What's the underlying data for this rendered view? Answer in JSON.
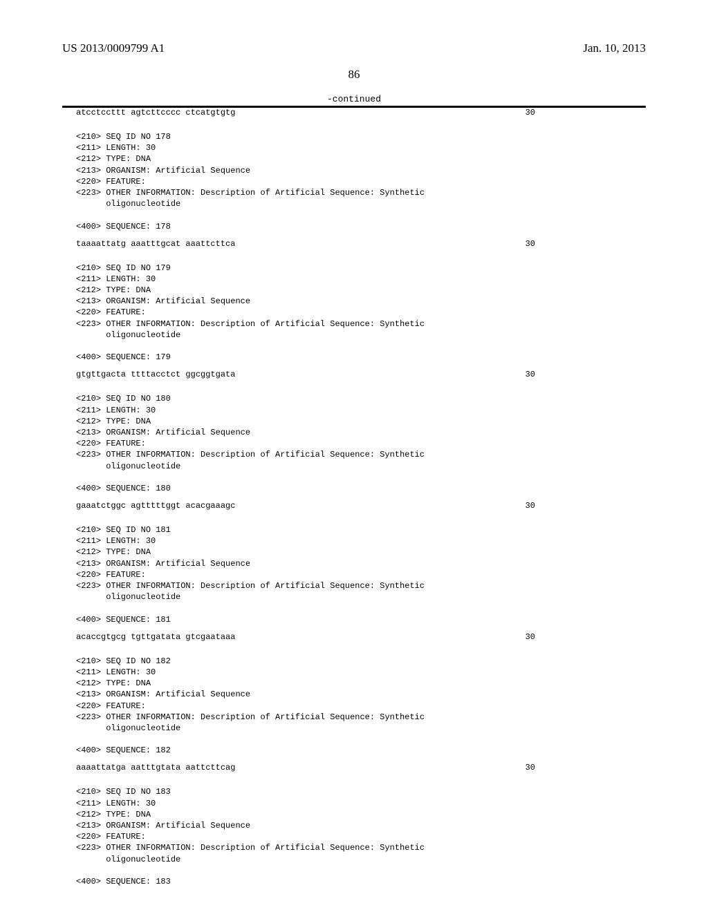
{
  "header": {
    "pub_number": "US 2013/0009799 A1",
    "date": "Jan. 10, 2013"
  },
  "page_number": "86",
  "continued_label": "-continued",
  "prev_sequence": {
    "data": "atcctccttt agtcttcccc ctcatgtgtg",
    "length": "30"
  },
  "entries": [
    {
      "id": "178",
      "length": "30",
      "type": "DNA",
      "organism": "Artificial Sequence",
      "feature": "",
      "other_info": "Description of Artificial Sequence: Synthetic",
      "other_info_cont": "oligonucleotide",
      "sequence_label": "178",
      "seq_data": "taaaattatg aaatttgcat aaattcttca",
      "seq_len": "30"
    },
    {
      "id": "179",
      "length": "30",
      "type": "DNA",
      "organism": "Artificial Sequence",
      "feature": "",
      "other_info": "Description of Artificial Sequence: Synthetic",
      "other_info_cont": "oligonucleotide",
      "sequence_label": "179",
      "seq_data": "gtgttgacta ttttacctct ggcggtgata",
      "seq_len": "30"
    },
    {
      "id": "180",
      "length": "30",
      "type": "DNA",
      "organism": "Artificial Sequence",
      "feature": "",
      "other_info": "Description of Artificial Sequence: Synthetic",
      "other_info_cont": "oligonucleotide",
      "sequence_label": "180",
      "seq_data": "gaaatctggc agtttttggt acacgaaagc",
      "seq_len": "30"
    },
    {
      "id": "181",
      "length": "30",
      "type": "DNA",
      "organism": "Artificial Sequence",
      "feature": "",
      "other_info": "Description of Artificial Sequence: Synthetic",
      "other_info_cont": "oligonucleotide",
      "sequence_label": "181",
      "seq_data": "acaccgtgcg tgttgatata gtcgaataaa",
      "seq_len": "30"
    },
    {
      "id": "182",
      "length": "30",
      "type": "DNA",
      "organism": "Artificial Sequence",
      "feature": "",
      "other_info": "Description of Artificial Sequence: Synthetic",
      "other_info_cont": "oligonucleotide",
      "sequence_label": "182",
      "seq_data": "aaaattatga aatttgtata aattcttcag",
      "seq_len": "30"
    },
    {
      "id": "183",
      "length": "30",
      "type": "DNA",
      "organism": "Artificial Sequence",
      "feature": "",
      "other_info": "Description of Artificial Sequence: Synthetic",
      "other_info_cont": "oligonucleotide",
      "sequence_label": "183",
      "seq_data": "",
      "seq_len": ""
    }
  ],
  "labels": {
    "seq_id": "<210> SEQ ID NO ",
    "length": "<211> LENGTH: ",
    "type": "<212> TYPE: ",
    "organism": "<213> ORGANISM: ",
    "feature": "<220> FEATURE:",
    "other": "<223> OTHER INFORMATION: ",
    "sequence": "<400> SEQUENCE: "
  }
}
